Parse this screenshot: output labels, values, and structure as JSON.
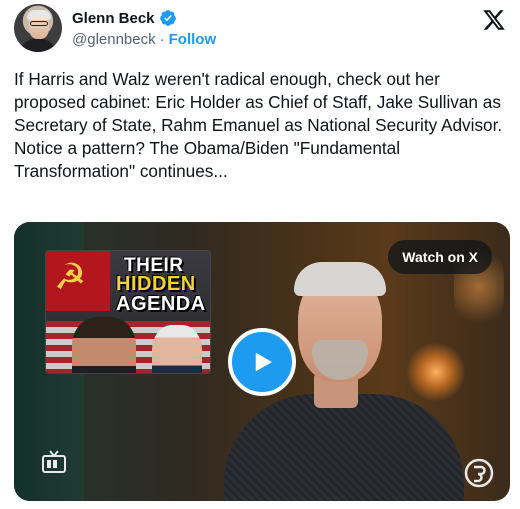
{
  "author": {
    "name": "Glenn Beck",
    "handle": "@glennbeck",
    "separator": "·",
    "follow_label": "Follow",
    "avatar_icon": "profile-photo",
    "verified_icon": "verified-badge-icon"
  },
  "platform": {
    "logo_icon": "x-logo-icon"
  },
  "tweet": {
    "text": "If Harris and Walz weren't radical enough, check out her proposed cabinet: Eric Holder as Chief of Staff, Jake Sullivan as Secretary of State, Rahm Emanuel as National Security Advisor. Notice a pattern? The Obama/Biden \"Fundamental Transformation\" continues..."
  },
  "media": {
    "watch_label": "Watch on X",
    "thumbnail": {
      "line1": "THEIR",
      "line2": "HIDDEN",
      "line3": "AGENDA"
    },
    "play_icon": "play-icon",
    "channel_icon": "tv-icon",
    "brand_icon": "blaze-logo-icon"
  },
  "colors": {
    "accent": "#1d9bf0",
    "text": "#0f1419",
    "muted": "#536471"
  }
}
